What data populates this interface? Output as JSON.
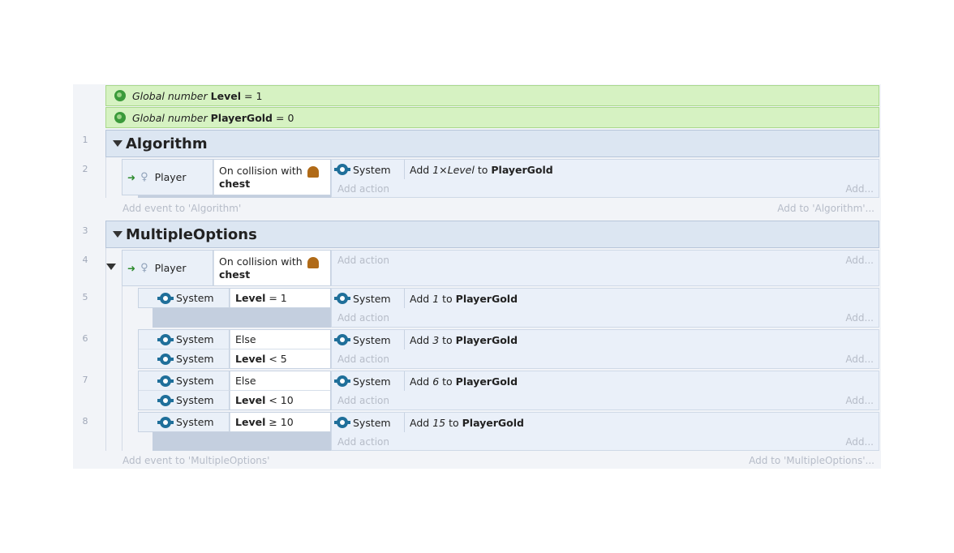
{
  "variables": [
    {
      "kind": "Global number",
      "name": "Level",
      "op": "=",
      "value": "1"
    },
    {
      "kind": "Global number",
      "name": "PlayerGold",
      "op": "=",
      "value": "0"
    }
  ],
  "row_numbers": [
    "1",
    "2",
    "3",
    "4",
    "5",
    "6",
    "7",
    "8"
  ],
  "groups": [
    {
      "title": "Algorithm",
      "add_event": "Add event to 'Algorithm'",
      "add_to": "Add to 'Algorithm'..."
    },
    {
      "title": "MultipleOptions",
      "add_event": "Add event to 'MultipleOptions'",
      "add_to": "Add to 'MultipleOptions'..."
    }
  ],
  "common": {
    "player": "Player",
    "system": "System",
    "on_collision": "On collision with",
    "chest": "chest",
    "add_action": "Add action",
    "add_more": "Add...",
    "else": "Else",
    "add": "Add",
    "to": "to",
    "playergold": "PlayerGold",
    "level": "Level"
  },
  "event2": {
    "action_amount": "1×Level"
  },
  "event5": {
    "cond_op": "= 1",
    "amount": "1"
  },
  "event6": {
    "cond_op": "< 5",
    "amount": "3"
  },
  "event7": {
    "cond_op": "< 10",
    "amount": "6"
  },
  "event8": {
    "cond_op": "≥ 10",
    "amount": "15"
  }
}
